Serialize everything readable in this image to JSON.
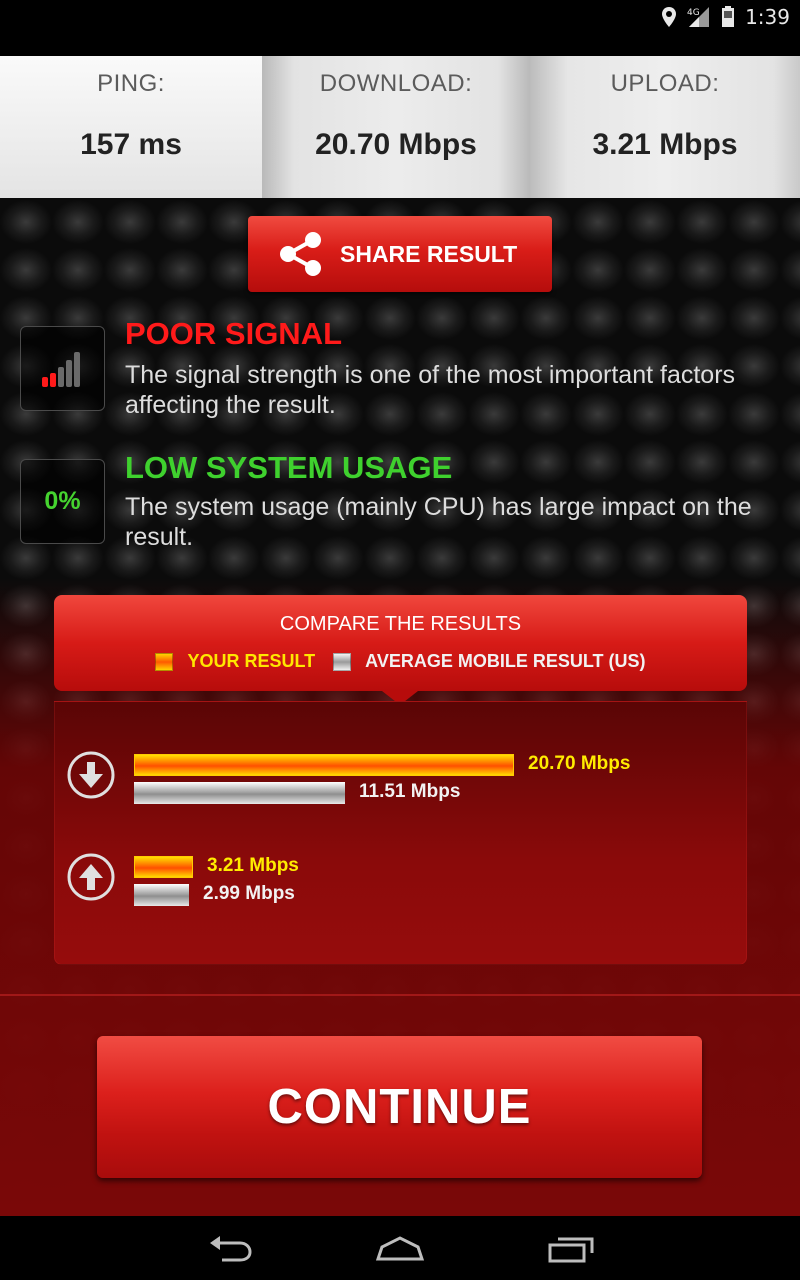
{
  "status_bar": {
    "time": "1:39",
    "network": "4G",
    "icons": [
      "location-icon",
      "signal-icon",
      "battery-icon"
    ]
  },
  "stats": {
    "ping": {
      "label": "PING:",
      "value": "157 ms"
    },
    "download": {
      "label": "DOWNLOAD:",
      "value": "20.70 Mbps"
    },
    "upload": {
      "label": "UPLOAD:",
      "value": "3.21 Mbps"
    }
  },
  "share": {
    "label": "SHARE RESULT",
    "icon": "share-icon"
  },
  "signal": {
    "heading": "POOR SIGNAL",
    "description": "The signal strength is one of the most important factors affecting the result.",
    "icon": "signal-bars-icon",
    "color": "#ff1a1a"
  },
  "usage": {
    "heading": "LOW SYSTEM USAGE",
    "description": "The system usage (mainly CPU) has large impact on the result.",
    "percent": "0%",
    "color": "#3fd12e"
  },
  "compare": {
    "title": "COMPARE THE RESULTS",
    "legend_yours": "YOUR RESULT",
    "legend_average": "AVERAGE MOBILE RESULT (US)",
    "download": {
      "yours_value": 20.7,
      "yours_label": "20.70 Mbps",
      "avg_value": 11.51,
      "avg_label": "11.51 Mbps"
    },
    "upload": {
      "yours_value": 3.21,
      "yours_label": "3.21 Mbps",
      "avg_value": 2.99,
      "avg_label": "2.99 Mbps"
    }
  },
  "continue": {
    "label": "CONTINUE"
  },
  "nav": {
    "icons": [
      "back-icon",
      "home-icon",
      "recents-icon"
    ]
  }
}
